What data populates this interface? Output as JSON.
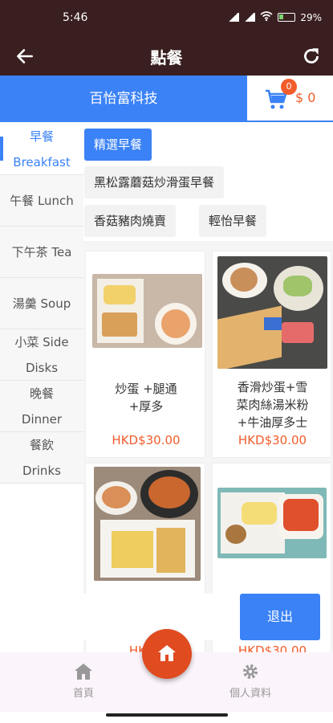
{
  "status_bar": {
    "time": "5:46",
    "battery": "29%"
  },
  "app_bar": {
    "title": "點餐"
  },
  "shop": {
    "name": "百怡富科技"
  },
  "cart": {
    "count": "0",
    "total": "$ 0"
  },
  "sidebar": {
    "items": [
      {
        "line1": "早餐",
        "line2": "Breakfast"
      },
      {
        "line1": "午餐 Lunch",
        "line2": ""
      },
      {
        "line1": "下午茶 Tea",
        "line2": ""
      },
      {
        "line1": "湯羹 Soup",
        "line2": ""
      },
      {
        "line1": "小菜 Side",
        "line2": "Disks"
      },
      {
        "line1": "晚餐",
        "line2": "Dinner"
      },
      {
        "line1": "餐飲",
        "line2": "Drinks"
      }
    ]
  },
  "subcategories": [
    "精選早餐",
    "黑松露蘑菇炒滑蛋早餐",
    "香菇豬肉燒賣",
    "輕怡早餐"
  ],
  "products": [
    {
      "name_line1": "炒蛋 +腿通",
      "name_line2": "+厚多",
      "name_line3": "",
      "price": "HKD$30.00"
    },
    {
      "name_line1": "香滑炒蛋+雪",
      "name_line2": "菜肉絲湯米粉",
      "name_line3": "+牛油厚多士",
      "price": "HKD$30.00"
    },
    {
      "name_line1": "",
      "name_line2": "",
      "name_line3": "",
      "price": "HKD$"
    },
    {
      "name_line1": "",
      "name_line2": "",
      "name_line3": "",
      "price": "HKD$30.00"
    }
  ],
  "overlay": {
    "exit_label": "退出"
  },
  "bottom_nav": {
    "home_label": "首頁",
    "profile_label": "個人資料"
  },
  "colors": {
    "accent": "#3b82f6",
    "header": "#3a1f20",
    "price": "#f25c2b",
    "fab": "#e04b20"
  }
}
